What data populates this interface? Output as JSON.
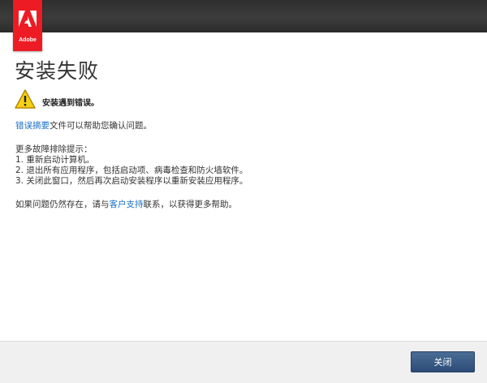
{
  "brand": {
    "logo_text": "Adobe",
    "color": "#ed1c24"
  },
  "dialog": {
    "title": "安装失败",
    "alert_icon": "warning-icon",
    "alert_message": "安装遇到错误。",
    "summary_link": "错误摘要",
    "summary_text": "文件可以帮助您确认问题。",
    "tips_heading": "更多故障排除提示：",
    "tips": [
      "1. 重新启动计算机。",
      "2. 退出所有应用程序，包括启动项、病毒检查和防火墙软件。",
      "3. 关闭此窗口，然后再次启动安装程序以重新安装应用程序。"
    ],
    "support_prefix": "如果问题仍然存在，请与",
    "support_link": "客户支持",
    "support_suffix": "联系，以获得更多帮助。",
    "link_color": "#1a6ec4"
  },
  "footer": {
    "close_label": "关闭"
  }
}
